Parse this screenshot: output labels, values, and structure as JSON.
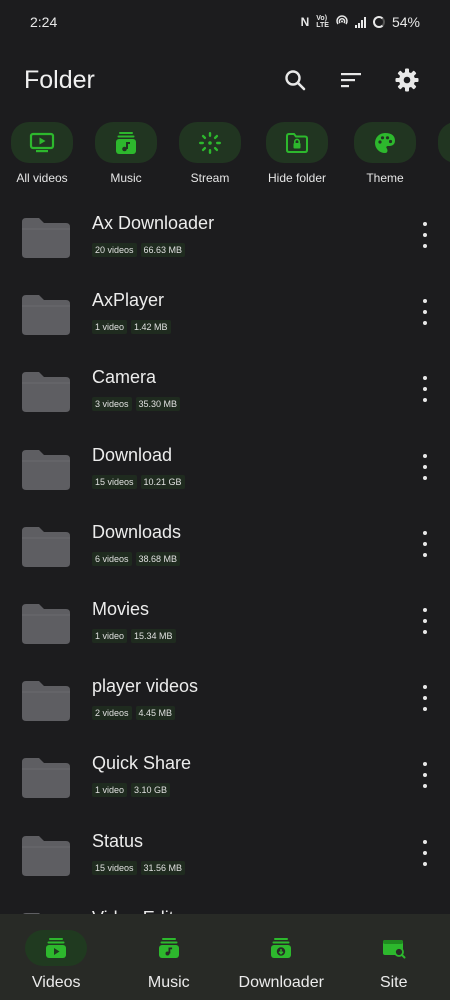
{
  "status_bar": {
    "time": "2:24",
    "volte_top": "Vo)",
    "volte_bottom": "LTE",
    "battery": "54%"
  },
  "header": {
    "title": "Folder",
    "actions": [
      "search-icon",
      "sort-icon",
      "gear-icon"
    ]
  },
  "accent_color": "#2db82d",
  "shortcuts": [
    {
      "label": "All videos",
      "icon": "tv-play-icon"
    },
    {
      "label": "Music",
      "icon": "music-note-icon"
    },
    {
      "label": "Stream",
      "icon": "stream-icon"
    },
    {
      "label": "Hide folder",
      "icon": "lock-folder-icon"
    },
    {
      "label": "Theme",
      "icon": "palette-icon"
    }
  ],
  "folders": [
    {
      "name": "Ax Downloader",
      "count": "20 videos",
      "size": "66.63 MB"
    },
    {
      "name": "AxPlayer",
      "count": "1 video",
      "size": "1.42 MB"
    },
    {
      "name": "Camera",
      "count": "3 videos",
      "size": "35.30 MB"
    },
    {
      "name": "Download",
      "count": "15 videos",
      "size": "10.21 GB"
    },
    {
      "name": "Downloads",
      "count": "6 videos",
      "size": "38.68 MB"
    },
    {
      "name": "Movies",
      "count": "1 video",
      "size": "15.34 MB"
    },
    {
      "name": "player videos",
      "count": "2 videos",
      "size": "4.45 MB"
    },
    {
      "name": "Quick Share",
      "count": "1 video",
      "size": "3.10 GB"
    },
    {
      "name": "Status",
      "count": "15 videos",
      "size": "31.56 MB"
    },
    {
      "name": "Video Edit",
      "count": "",
      "size": ""
    }
  ],
  "bottom_nav": [
    {
      "label": "Videos",
      "icon": "video-library-icon",
      "active": true
    },
    {
      "label": "Music",
      "icon": "music-library-icon",
      "active": false
    },
    {
      "label": "Downloader",
      "icon": "download-icon",
      "active": false
    },
    {
      "label": "Site",
      "icon": "browser-search-icon",
      "active": false
    }
  ]
}
